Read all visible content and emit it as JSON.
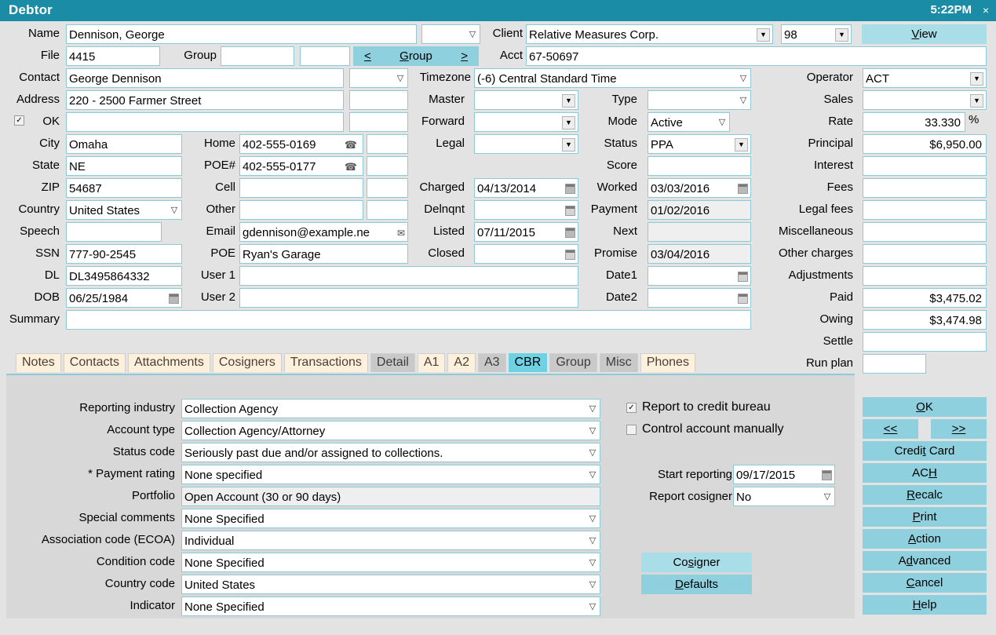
{
  "window": {
    "title": "Debtor",
    "clock": "5:22PM",
    "close": "×"
  },
  "header": {
    "labels": {
      "name": "Name",
      "file": "File",
      "group": "Group",
      "contact": "Contact",
      "address": "Address",
      "ok": "OK",
      "city": "City",
      "state": "State",
      "zip": "ZIP",
      "country": "Country",
      "speech": "Speech",
      "ssn": "SSN",
      "dl": "DL",
      "dob": "DOB",
      "summary": "Summary",
      "home": "Home",
      "poe_num": "POE#",
      "cell": "Cell",
      "other": "Other",
      "email": "Email",
      "poe": "POE",
      "user1": "User 1",
      "user2": "User 2",
      "timezone": "Timezone",
      "master": "Master",
      "forward": "Forward",
      "legal": "Legal",
      "charged": "Charged",
      "delnqnt": "Delnqnt",
      "listed": "Listed",
      "closed": "Closed",
      "client": "Client",
      "acct": "Acct",
      "type": "Type",
      "mode": "Mode",
      "status": "Status",
      "score": "Score",
      "worked": "Worked",
      "payment": "Payment",
      "next": "Next",
      "promise": "Promise",
      "date1": "Date1",
      "date2": "Date2",
      "operator": "Operator",
      "sales": "Sales",
      "rate": "Rate",
      "principal": "Principal",
      "interest": "Interest",
      "fees": "Fees",
      "legal_fees": "Legal fees",
      "miscellaneous": "Miscellaneous",
      "other_charges": "Other charges",
      "adjustments": "Adjustments",
      "paid": "Paid",
      "owing": "Owing",
      "settle": "Settle",
      "run_plan": "Run plan"
    },
    "values": {
      "name": "Dennison, George",
      "name_suffix": "",
      "file": "4415",
      "group": "",
      "group2": "",
      "contact": "George Dennison",
      "contact_combo": "",
      "address": "220 - 2500 Farmer Street",
      "address2": "",
      "address_side1": "",
      "address_side2": "",
      "city": "Omaha",
      "state": "NE",
      "zip": "54687",
      "country": "United States",
      "speech": "",
      "ssn": "777-90-2545",
      "dl": "DL3495864332",
      "dob": "06/25/1984",
      "summary": "",
      "home": "402-555-0169",
      "home_ext": "",
      "poe_num": "402-555-0177",
      "poe_num_ext": "",
      "cell": "",
      "cell_ext": "",
      "other": "",
      "other_ext": "",
      "email": "gdennison@example.ne",
      "poe": "Ryan's Garage",
      "user1": "",
      "user2": "",
      "timezone": "(-6) Central Standard Time",
      "master": "",
      "forward": "",
      "legal": "",
      "charged": "04/13/2014",
      "delnqnt": "",
      "listed": "07/11/2015",
      "closed": "",
      "client": "Relative Measures Corp.",
      "client_num": "98",
      "acct": "67-50697",
      "type": "",
      "mode": "Active",
      "status": "PPA",
      "score": "",
      "worked": "03/03/2016",
      "payment": "01/02/2016",
      "next": "",
      "promise": "03/04/2016",
      "date1": "",
      "date2": "",
      "operator": "ACT",
      "sales": "",
      "rate": "33.330",
      "rate_unit": "%",
      "principal": "$6,950.00",
      "interest": "",
      "fees": "",
      "legal_fees": "",
      "miscellaneous": "",
      "other_charges": "",
      "adjustments": "",
      "paid": "$3,475.02",
      "owing": "$3,474.98",
      "settle": "",
      "run_plan": ""
    },
    "ok_checked": true,
    "group_nav": {
      "prev": "<",
      "label": "Group",
      "next": ">"
    },
    "view_button": "View"
  },
  "tabs": [
    {
      "label": "Notes",
      "style": "cream",
      "active": false
    },
    {
      "label": "Contacts",
      "style": "cream",
      "active": false
    },
    {
      "label": "Attachments",
      "style": "cream",
      "active": false
    },
    {
      "label": "Cosigners",
      "style": "cream",
      "active": false
    },
    {
      "label": "Transactions",
      "style": "cream",
      "active": false
    },
    {
      "label": "Detail",
      "style": "gray",
      "active": false
    },
    {
      "label": "A1",
      "style": "cream",
      "active": false
    },
    {
      "label": "A2",
      "style": "cream",
      "active": false
    },
    {
      "label": "A3",
      "style": "gray",
      "active": false
    },
    {
      "label": "CBR",
      "style": "active",
      "active": true
    },
    {
      "label": "Group",
      "style": "gray",
      "active": false
    },
    {
      "label": "Misc",
      "style": "gray",
      "active": false
    },
    {
      "label": "Phones",
      "style": "cream",
      "active": false
    }
  ],
  "cbr": {
    "labels": {
      "reporting_industry": "Reporting industry",
      "account_type": "Account type",
      "status_code": "Status code",
      "payment_rating": "* Payment rating",
      "portfolio": "Portfolio",
      "special_comments": "Special comments",
      "association_code": "Association code (ECOA)",
      "condition_code": "Condition code",
      "country_code": "Country code",
      "indicator": "Indicator",
      "start_reporting": "Start reporting",
      "report_cosigner": "Report cosigner"
    },
    "values": {
      "reporting_industry": "Collection Agency",
      "account_type": "Collection Agency/Attorney",
      "status_code": "Seriously past due and/or assigned to collections.",
      "payment_rating": "None specified",
      "portfolio": "Open Account (30 or 90 days)",
      "special_comments": "None Specified",
      "association_code": "Individual",
      "condition_code": "None Specified",
      "country_code": "United States",
      "indicator": "None Specified",
      "start_reporting": "09/17/2015",
      "report_cosigner": "No"
    },
    "checkboxes": [
      {
        "label": "Report to credit bureau",
        "checked": true
      },
      {
        "label": "Control account manually",
        "checked": false
      }
    ],
    "cosigner_button": "Cosigner",
    "defaults_button": "Defaults"
  },
  "actions": {
    "ok": "OK",
    "prev": "<<",
    "next": ">>",
    "credit_card": "Credit Card",
    "ach": "ACH",
    "recalc": "Recalc",
    "print": "Print",
    "action": "Action",
    "advanced": "Advanced",
    "cancel": "Cancel",
    "help": "Help"
  },
  "colors": {
    "titlebar": "#1b8ca5",
    "accent": "#8ed0de",
    "accent_light": "#a9dde8",
    "tab_active": "#6fd2e3",
    "tab_cream": "#fdf0dc",
    "tab_gray": "#c9c9c9",
    "field_border": "#8ccad8",
    "window_bg": "#e3e3e3",
    "panel_bg": "#d8d8d8"
  },
  "icons": {
    "phone": "✆",
    "mail": "✉",
    "arrow_down": "▽",
    "arrow_down_solid": "▼",
    "check": "✓"
  }
}
